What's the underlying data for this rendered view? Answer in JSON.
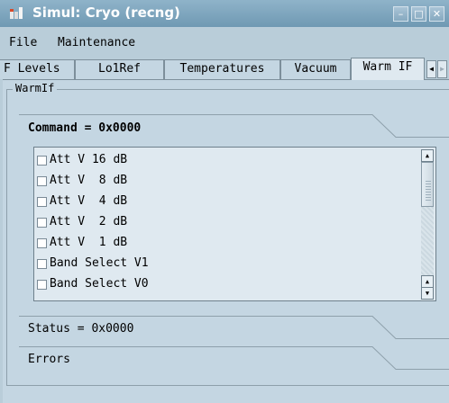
{
  "window": {
    "title": "Simul: Cryo (recng)"
  },
  "menubar": {
    "items": [
      "File",
      "Maintenance"
    ]
  },
  "tabs": {
    "items": [
      {
        "label": "F Levels"
      },
      {
        "label": "Lo1Ref"
      },
      {
        "label": "Temperatures"
      },
      {
        "label": "Vacuum"
      },
      {
        "label": "Warm IF"
      }
    ],
    "active": "Warm IF"
  },
  "group": {
    "title": "WarmIf"
  },
  "command": {
    "label": "Command = 0x0000"
  },
  "checkboxes": [
    {
      "label": "Att V 16 dB",
      "checked": false
    },
    {
      "label": "Att V  8 dB",
      "checked": false
    },
    {
      "label": "Att V  4 dB",
      "checked": false
    },
    {
      "label": "Att V  2 dB",
      "checked": false
    },
    {
      "label": "Att V  1 dB",
      "checked": false
    },
    {
      "label": "Band Select V1",
      "checked": false
    },
    {
      "label": "Band Select V0",
      "checked": false
    }
  ],
  "status": {
    "label": "Status = 0x0000"
  },
  "errors": {
    "label": "Errors"
  },
  "colors": {
    "titlebar": "#7aa2bb",
    "background": "#c4d6e2",
    "list_background": "#dfe9f0"
  }
}
